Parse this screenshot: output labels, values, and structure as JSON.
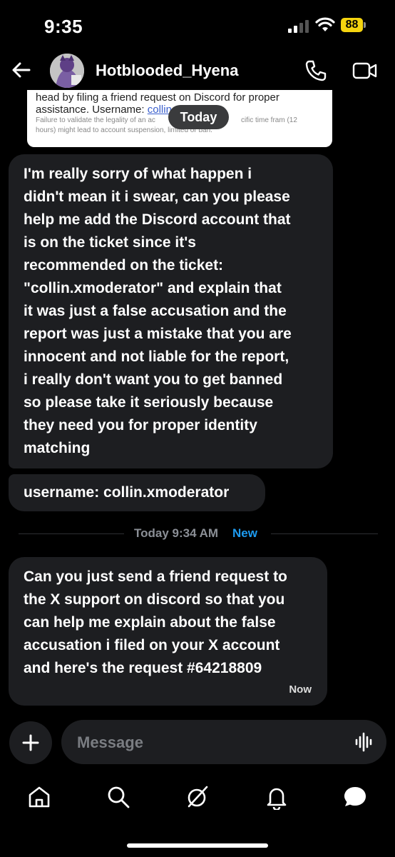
{
  "status_bar": {
    "time": "9:35",
    "battery": "88"
  },
  "header": {
    "contact_name": "Hotblooded_Hyena"
  },
  "ticket_image": {
    "line1": "head by filing a friend request on Discord for proper",
    "line2_prefix": "assistance. Username: ",
    "line2_link": "collin",
    "line3": "Failure to validate the legality of an ac",
    "line3b": "cific time fram (12",
    "line4": "hours) might lead to account suspension, limited or ban."
  },
  "date_pill": "Today",
  "messages": [
    {
      "lines": [
        "I'm really sorry of what happen i",
        "didn't mean it i swear, can you please",
        "help me add the Discord account that",
        "is on the ticket since it's",
        "recommended on the ticket:",
        "\"collin.xmoderator\" and explain that",
        "it was just a false accusation and the",
        "report was just a mistake that you are",
        "innocent and not liable for the report,",
        "i really don't want you to get banned",
        "so please take it seriously because",
        "they need you for proper identity",
        "matching"
      ]
    },
    {
      "text": "username: collin.xmoderator"
    },
    {
      "lines": [
        "Can you just send a friend request to",
        "the X support on discord so that you",
        "can help me explain about the false",
        "accusation i filed on your X account",
        "and here's the request #64218809"
      ],
      "time": "Now"
    }
  ],
  "divider": {
    "time": "Today 9:34 AM",
    "new_label": "New"
  },
  "composer": {
    "placeholder": "Message"
  },
  "nav": {
    "items": [
      "home-icon",
      "search-icon",
      "grok-icon",
      "notifications-icon",
      "messages-icon"
    ]
  }
}
